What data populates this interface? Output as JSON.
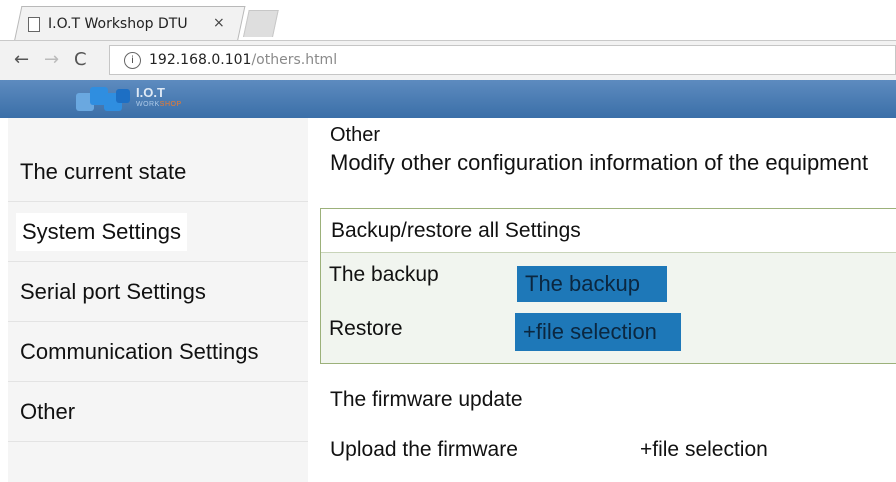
{
  "browser": {
    "tab_title": "I.O.T Workshop DTU",
    "tab_close": "×",
    "nav_back": "←",
    "nav_forward": "→",
    "nav_reload": "C",
    "info_icon": "i",
    "url_host": "192.168.0.101",
    "url_path": "/others.html"
  },
  "header": {
    "logo_main": "I.O.T",
    "logo_sub_left": "WORK",
    "logo_sub_right": "SHOP",
    "logo_color": "#2f8ee0",
    "accent_color": "#f07a2a"
  },
  "sidebar": {
    "items": [
      {
        "label": "The current state"
      },
      {
        "label": "System Settings"
      },
      {
        "label": "Serial port Settings"
      },
      {
        "label": "Communication Settings"
      },
      {
        "label": "Other"
      }
    ]
  },
  "main": {
    "title": "Other",
    "description": "Modify other configuration information of the equipment",
    "panel": {
      "heading": "Backup/restore all Settings",
      "backup_label": "The backup",
      "backup_button": "The backup",
      "restore_label": "Restore",
      "restore_button": "+file selection"
    },
    "firmware": {
      "title": "The firmware update",
      "upload_label": "Upload the firmware",
      "upload_button": "+file selection"
    }
  },
  "colors": {
    "header_blue": "#3b6fa8",
    "button_blue": "#1e78b8",
    "panel_border": "#9cb17a"
  }
}
